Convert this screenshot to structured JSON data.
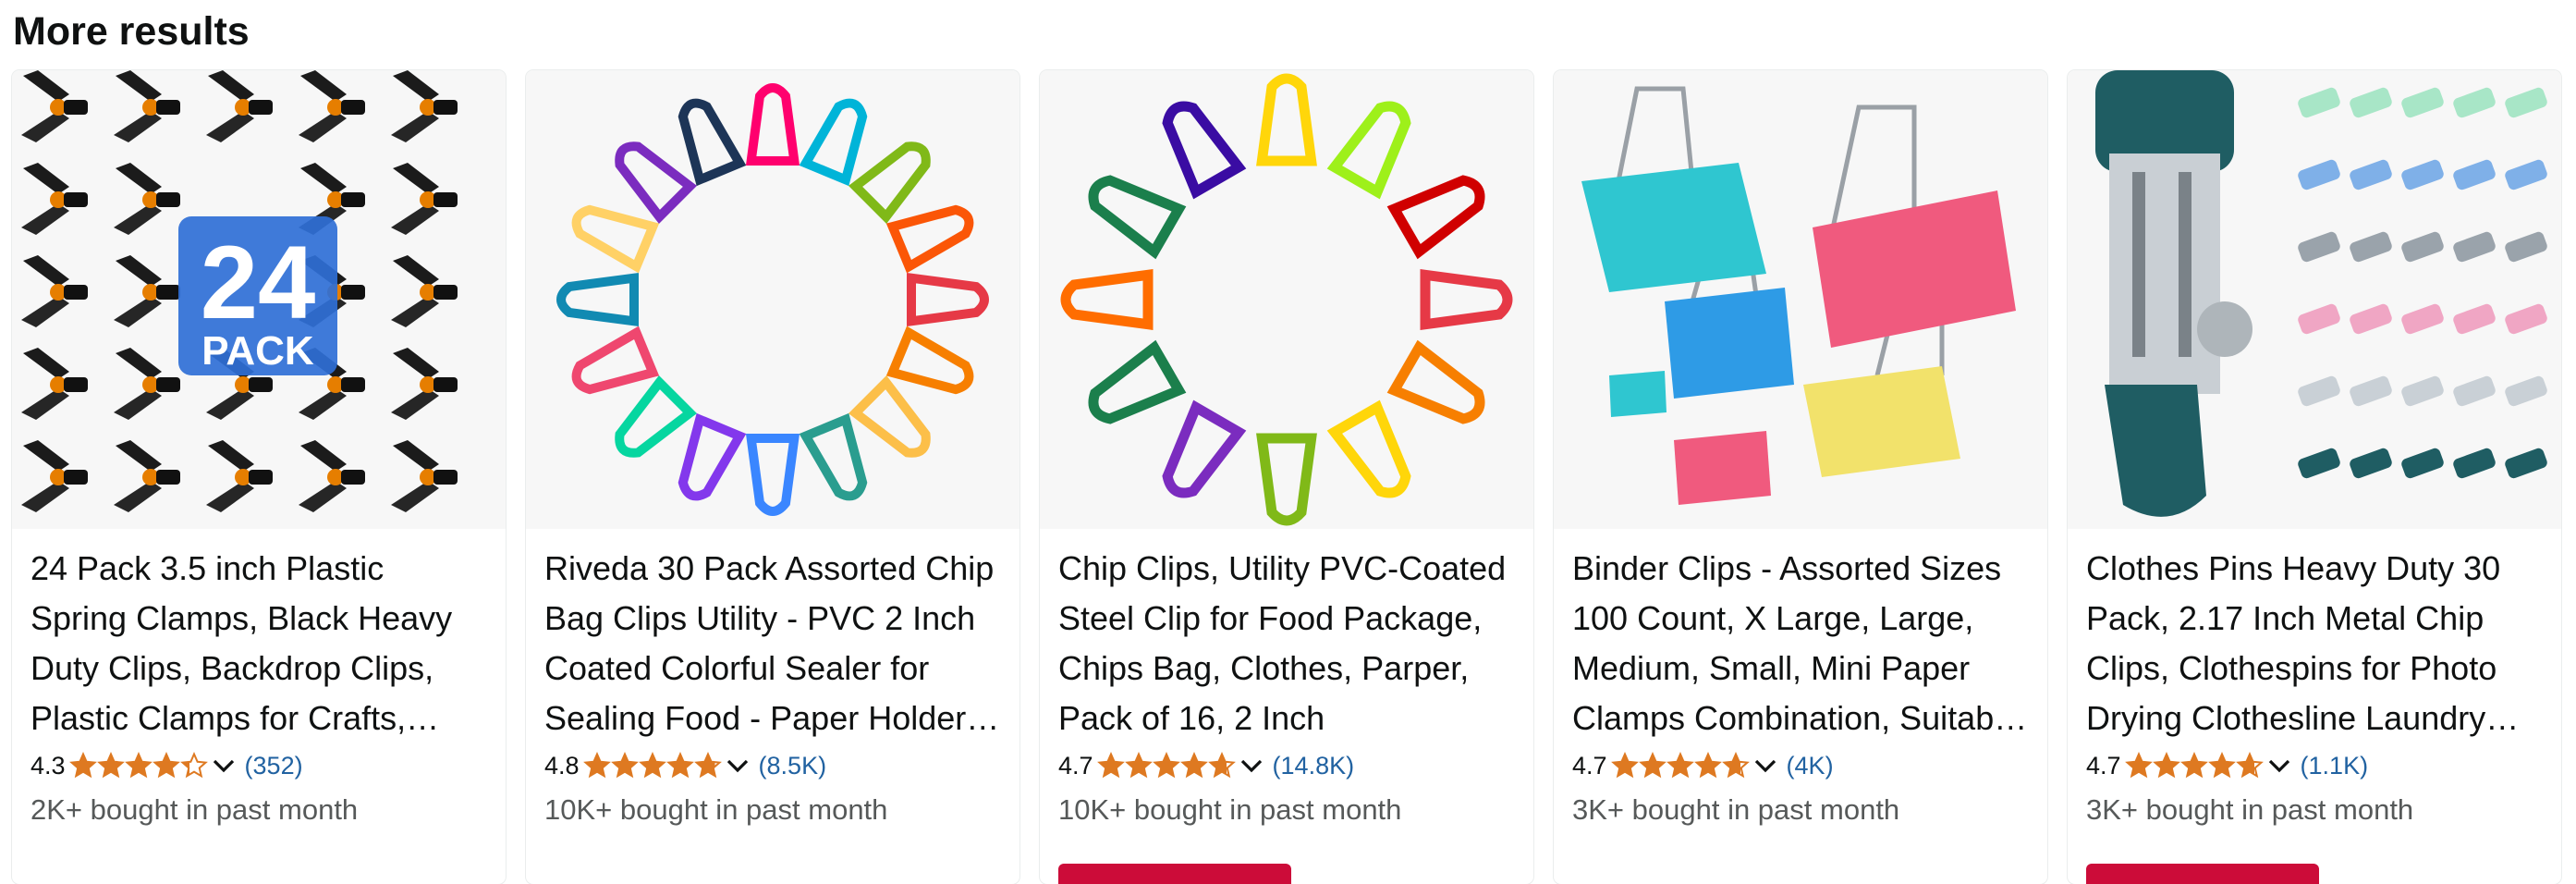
{
  "section": {
    "heading": "More results"
  },
  "colors": {
    "star": "#de7921",
    "link": "#2162a1",
    "deal": "#cc0c39",
    "muted": "#565959"
  },
  "products": [
    {
      "title": "24 Pack 3.5 inch Plastic Spring Clamps, Black Heavy Duty Clips, Backdrop Clips, Plastic Clamps for Crafts, Photography, Woodworking",
      "badge_num": "24",
      "badge_text": "PACK",
      "rating": "4.3",
      "stars": 4.3,
      "reviews": "(352)",
      "bought": "2K+ bought in past month",
      "has_deal": false
    },
    {
      "title": "Riveda 30 Pack Assorted Chip Bag Clips Utility - PVC 2 Inch Coated Colorful Sealer for Sealing Food - Paper Holder Clips",
      "rating": "4.8",
      "stars": 4.8,
      "reviews": "(8.5K)",
      "bought": "10K+ bought in past month",
      "has_deal": false
    },
    {
      "title": "Chip Clips, Utility PVC-Coated Steel Clip for Food Package, Chips Bag, Clothes, Parper, Pack of 16, 2 Inch",
      "rating": "4.7",
      "stars": 4.7,
      "reviews": "(14.8K)",
      "bought": "10K+ bought in past month",
      "has_deal": true
    },
    {
      "title": "Binder Clips - Assorted Sizes 100 Count, X Large, Large, Medium, Small, Mini Paper Clamps Combination, Suitable for Office",
      "rating": "4.7",
      "stars": 4.7,
      "reviews": "(4K)",
      "bought": "3K+ bought in past month",
      "has_deal": false
    },
    {
      "title": "Clothes Pins Heavy Duty 30 Pack, 2.17 Inch Metal Chip Clips, Clothespins for Photo Drying Clothesline Laundry Crafts",
      "rating": "4.7",
      "stars": 4.7,
      "reviews": "(1.1K)",
      "bought": "3K+ bought in past month",
      "has_deal": true
    }
  ]
}
